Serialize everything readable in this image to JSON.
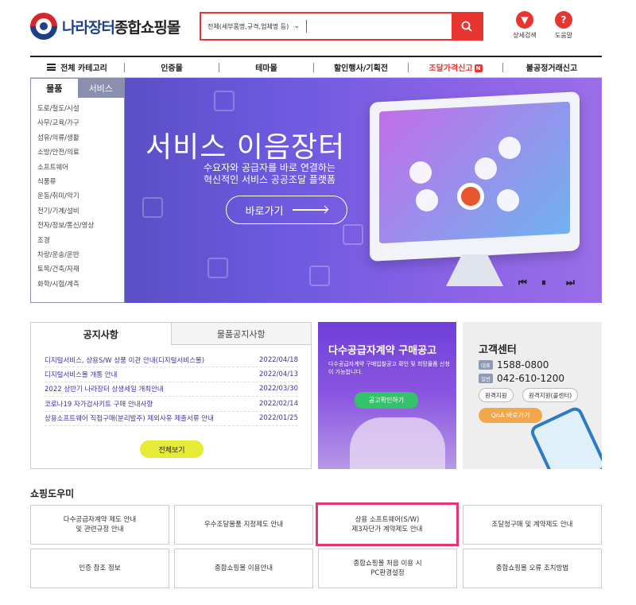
{
  "logo": {
    "main": "나라장터",
    "accent": "종합쇼핑몰"
  },
  "search": {
    "scope": "전체(세부품명,규격,업체명 등)",
    "placeholder": ""
  },
  "utils": [
    {
      "icon": "filter-icon",
      "label": "상세검색"
    },
    {
      "icon": "help-icon",
      "label": "도움말"
    }
  ],
  "nav": {
    "all": "전체 카테고리",
    "items": [
      "인증몰",
      "테마몰",
      "할인행사/기획전",
      "조달가격신고",
      "불공정거래신고"
    ],
    "badge": "N",
    "accent": "#e8352f"
  },
  "category": {
    "tabs": [
      "물품",
      "서비스"
    ],
    "items": [
      "도로/철도/시설",
      "사무/교육/가구",
      "섬유/의류/생활",
      "소방/안전/의료",
      "소프트웨어",
      "식품류",
      "운동/취미/악기",
      "전기/기계/설비",
      "전자/정보/통신/영상",
      "조경",
      "차량/운송/운반",
      "토목/건축/자재",
      "화학/시험/계측"
    ]
  },
  "banner": {
    "title": "서비스 이음장터",
    "sub1": "수요자와 공급자를 바로 연결하는",
    "sub2": "혁신적인 서비스 공공조달 플랫폼",
    "button": "바로가기",
    "controls": [
      "prev-icon",
      "pause-icon",
      "next-icon"
    ]
  },
  "notice": {
    "tabs": [
      "공지사항",
      "물품공지사항"
    ],
    "rows": [
      {
        "title": "디지털서비스, 상용S/W 상품 이관 안내(디지털서비스몰)",
        "date": "2022/04/18"
      },
      {
        "title": "디지털서비스몰 개통 안내",
        "date": "2022/04/13"
      },
      {
        "title": "2022 상반기 나라장터 상생세일 개최안내",
        "date": "2022/03/30"
      },
      {
        "title": "코로나19 자가검사키트 구매 안내사항",
        "date": "2022/02/14"
      },
      {
        "title": "상용소프트웨어 직접구매(분리발주) 제외사유 제출서류 안내",
        "date": "2022/01/25"
      }
    ],
    "more": "전체보기"
  },
  "promo": {
    "title": "다수공급자계약 구매공고",
    "desc": "다수공급자계약 구매입찰공고 확인 및 희망물품 신청이 가능합니다.",
    "button": "공고확인하기"
  },
  "cs": {
    "title": "고객센터",
    "tag1": "대표",
    "num1": "1588-0800",
    "tag2": "일반",
    "num2": "042-610-1200",
    "pill1": "원격지원",
    "pill2": "원격지원(콜센터)",
    "qna": "QnA 바로가기"
  },
  "help": {
    "title": "쇼핑도우미",
    "boxes": [
      [
        "다수공급자계약 제도 안내",
        "및 관련규정 안내"
      ],
      [
        "우수조달물품 지정제도 안내",
        ""
      ],
      [
        "상용 소프트웨어(S/W)",
        "제3자단가 계약제도 안내"
      ],
      [
        "조달청구매 및 계약제도 안내",
        ""
      ],
      [
        "인증 참조 정보",
        ""
      ],
      [
        "종합쇼핑몰 이용안내",
        ""
      ],
      [
        "종합쇼핑몰 처음 이용 시",
        "PC환경설정"
      ],
      [
        "종합쇼핑몰 오류 조치방법",
        ""
      ]
    ]
  }
}
